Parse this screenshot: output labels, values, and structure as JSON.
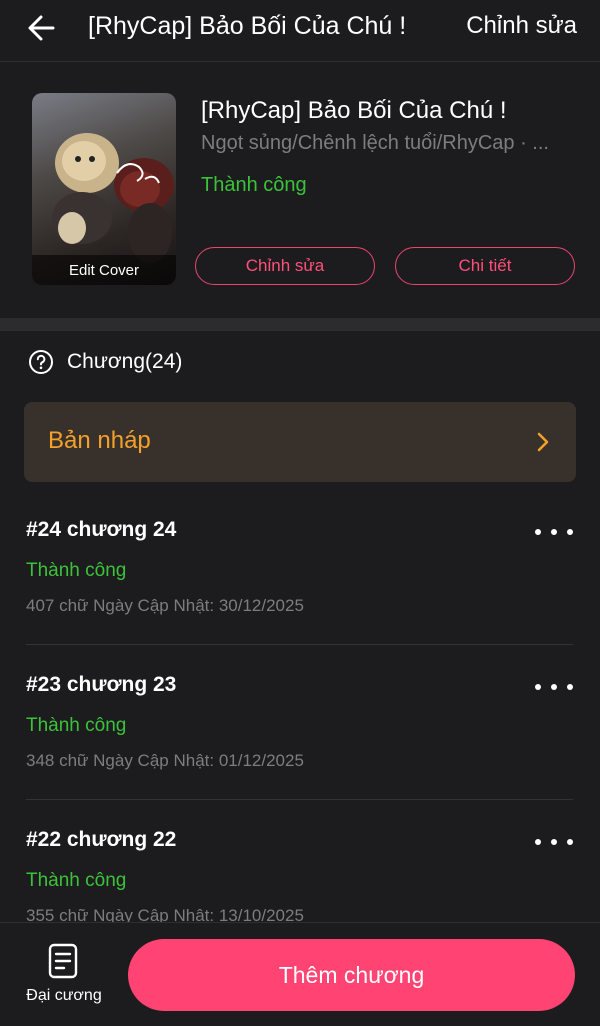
{
  "header": {
    "back_icon": "arrow-left-icon",
    "title": "[RhyCap] Bảo Bối Của Chú !",
    "edit_label": "Chỉnh sửa"
  },
  "book": {
    "cover_label": "Edit Cover",
    "title": "[RhyCap] Bảo Bối Của Chú !",
    "tags": "Ngọt sủng/Chênh lệch tuổi/RhyCap · ...",
    "status": "Thành công",
    "edit_button": "Chỉnh sửa",
    "detail_button": "Chi tiết"
  },
  "chapters": {
    "help_icon": "question-circle-icon",
    "label": "Chương(24)",
    "draft_label": "Bản nháp",
    "draft_icon": "chevron-right-icon",
    "items": [
      {
        "title": "#24 chương 24",
        "status": "Thành công",
        "meta": "407 chữ Ngày Cập Nhật: 30/12/2025"
      },
      {
        "title": "#23 chương 23",
        "status": "Thành công",
        "meta": "348 chữ Ngày Cập Nhật: 01/12/2025"
      },
      {
        "title": "#22 chương 22",
        "status": "Thành công",
        "meta": "355 chữ Ngày Cập Nhật: 13/10/2025"
      }
    ]
  },
  "bottom": {
    "outline_icon": "document-list-icon",
    "outline_label": "Đại cương",
    "add_button": "Thêm chương"
  },
  "colors": {
    "background": "#1c1c1e",
    "accent_pink": "#ff4473",
    "success_green": "#3cc23a",
    "draft_orange": "#f3a12a",
    "muted_text": "#7d7d80"
  }
}
